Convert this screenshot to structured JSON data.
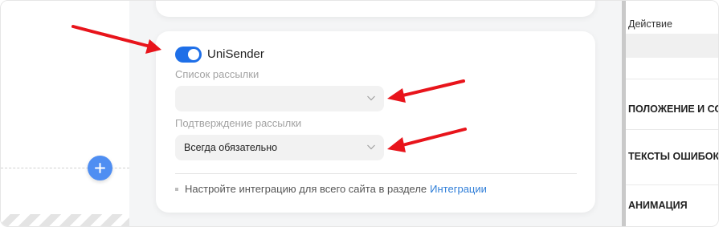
{
  "integration": {
    "name": "UniSender",
    "enabled": true
  },
  "fields": {
    "list": {
      "label": "Список рассылки",
      "value": ""
    },
    "confirmation": {
      "label": "Подтверждение рассылки",
      "value": "Всегда обязательно"
    }
  },
  "note": {
    "text": "Настройте интеграцию для всего сайта в разделе",
    "link": "Интеграции"
  },
  "right_panel": {
    "header": "Действие",
    "sections": [
      "ПОЛОЖЕНИЕ И СОСТОЯНИЕ",
      "ТЕКСТЫ ОШИБОК",
      "АНИМАЦИЯ"
    ]
  },
  "colors": {
    "accent": "#1e6fe8",
    "add_button": "#4f8ef2",
    "link": "#2f7ed8",
    "annotation_arrow": "#e8141b"
  },
  "icons": {
    "add": "plus-icon",
    "select": "chevron-down-icon"
  }
}
